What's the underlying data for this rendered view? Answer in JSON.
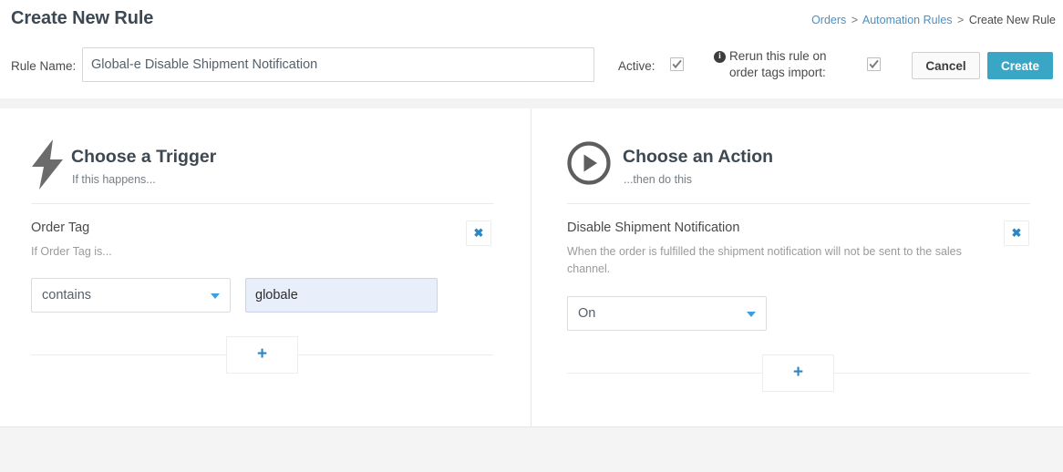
{
  "header": {
    "page_title": "Create New Rule",
    "breadcrumb": {
      "item1": "Orders",
      "sep1": ">",
      "item2": "Automation Rules",
      "sep2": ">",
      "current": "Create New Rule"
    }
  },
  "form": {
    "rule_name_label": "Rule Name:",
    "rule_name_value": "Global-e Disable Shipment Notification",
    "rule_name_placeholder": "",
    "active_label": "Active:",
    "active_checked": true,
    "info_icon_glyph": "i",
    "rerun_label": "Rerun this rule on order tags import:",
    "rerun_checked": true,
    "cancel_label": "Cancel",
    "create_label": "Create",
    "accent_color": "#3aa6c6",
    "link_color": "#4a90c4"
  },
  "trigger": {
    "icon": "lightning-bolt-icon",
    "title": "Choose a Trigger",
    "subtitle": "If this happens...",
    "item": {
      "title": "Order Tag",
      "description": "If Order Tag is...",
      "remove_label": "✖",
      "operator_value": "contains",
      "value_text": "globale"
    },
    "add_label": "+"
  },
  "action": {
    "icon": "play-circle-icon",
    "title": "Choose an Action",
    "subtitle": "...then do this",
    "item": {
      "title": "Disable Shipment Notification",
      "description": "When the order is fulfilled the shipment notification will not be sent to the sales channel.",
      "remove_label": "✖",
      "state_value": "On"
    },
    "add_label": "+"
  }
}
